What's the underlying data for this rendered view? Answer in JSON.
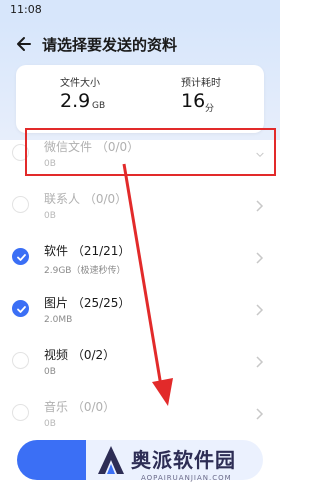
{
  "status": {
    "time": "11:08"
  },
  "header": {
    "title": "请选择要发送的资料"
  },
  "summary": {
    "file_size_label": "文件大小",
    "file_size_value": "2.9",
    "file_size_unit": "GB",
    "time_label": "预计耗时",
    "time_value": "16",
    "time_unit": "分"
  },
  "items": [
    {
      "title": "微信文件  （0/0）",
      "sub": "0B",
      "checked": false,
      "disabled": true
    },
    {
      "title": "联系人  （0/0）",
      "sub": "0B",
      "checked": false,
      "disabled": true
    },
    {
      "title": "软件  （21/21）",
      "sub": "2.9GB（极速秒传）",
      "checked": true,
      "disabled": false
    },
    {
      "title": "图片  （25/25）",
      "sub": "2.0MB",
      "checked": true,
      "disabled": false
    },
    {
      "title": "视频  （0/2）",
      "sub": "0B",
      "checked": false,
      "disabled": false
    },
    {
      "title": "音乐  （0/0）",
      "sub": "0B",
      "checked": false,
      "disabled": true
    }
  ],
  "watermark": {
    "text": "奥派软件园",
    "small": "AOPAIRUANJIAN.COM"
  },
  "colors": {
    "accent": "#3b6ff5",
    "highlight": "#e22a2a"
  }
}
